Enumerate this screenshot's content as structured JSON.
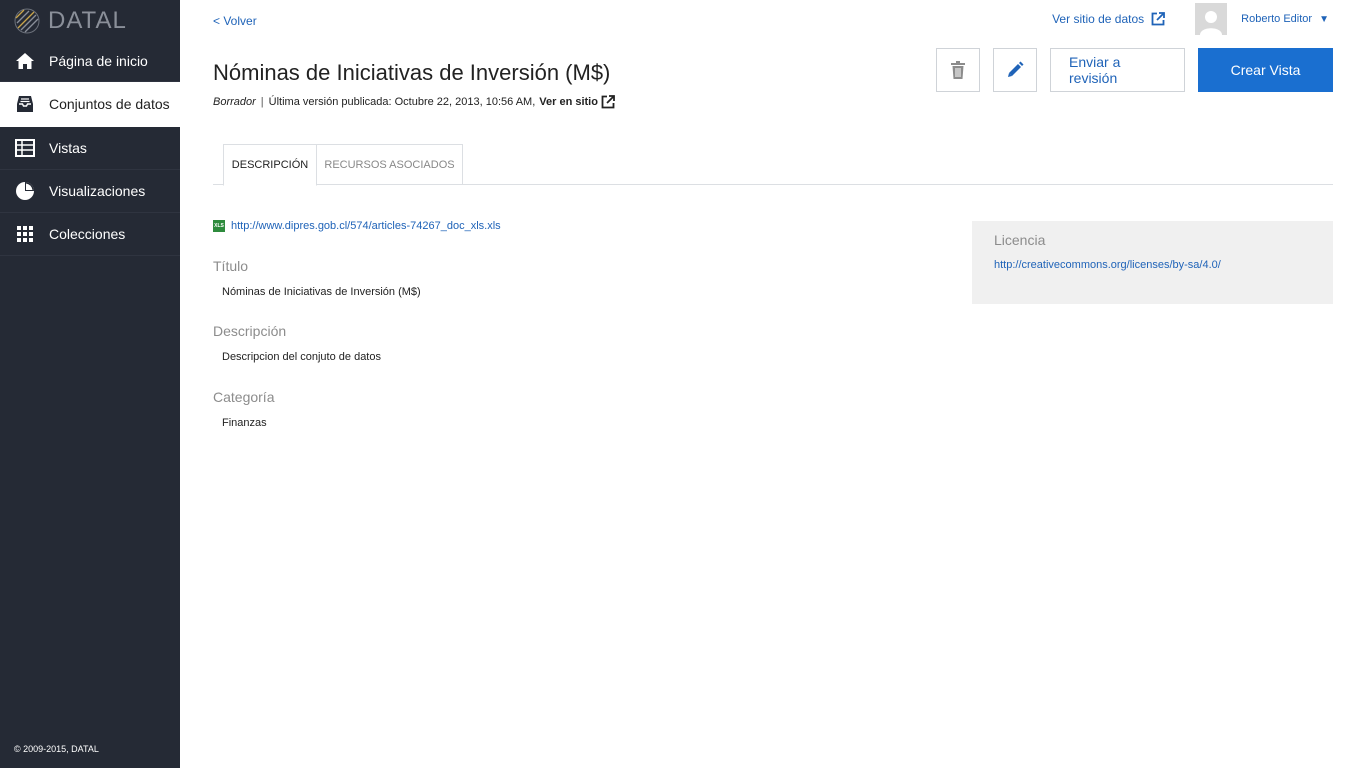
{
  "sidebar": {
    "logo_text": "DATAL",
    "items": [
      {
        "label": "Página de inicio",
        "icon": "home-icon"
      },
      {
        "label": "Conjuntos de datos",
        "icon": "inbox-icon"
      },
      {
        "label": "Vistas",
        "icon": "table-icon"
      },
      {
        "label": "Visualizaciones",
        "icon": "pie-chart-icon"
      },
      {
        "label": "Colecciones",
        "icon": "grid-icon"
      }
    ],
    "active_index": 1,
    "footer": "© 2009-2015, DATAL"
  },
  "header": {
    "back_label": "< Volver",
    "site_link_label": "Ver sitio de datos",
    "user_name": "Roberto Editor",
    "user_caret": "▼"
  },
  "dataset": {
    "title": "Nóminas de Iniciativas de Inversión (M$)",
    "status": "Borrador",
    "separator": "|",
    "published_text": "Última versión publicada: Octubre 22, 2013, 10:56 AM,",
    "view_site_label": "Ver en sitio"
  },
  "actions": {
    "delete_icon": "trash-icon",
    "edit_icon": "pencil-icon",
    "review_label": "Enviar a revisión",
    "create_view_label": "Crear Vista"
  },
  "tabs": [
    {
      "label": "DESCRIPCIÓN",
      "active": true
    },
    {
      "label": "RECURSOS ASOCIADOS",
      "active": false
    }
  ],
  "content": {
    "file_badge": "XLS",
    "file_url": "http://www.dipres.gob.cl/574/articles-74267_doc_xls.xls",
    "fields": [
      {
        "label": "Título",
        "value": "Nóminas de Iniciativas de Inversión (M$)"
      },
      {
        "label": "Descripción",
        "value": "Descripcion del conjuto de datos"
      },
      {
        "label": "Categoría",
        "value": "Finanzas"
      }
    ],
    "license_label": "Licencia",
    "license_url": "http://creativecommons.org/licenses/by-sa/4.0/"
  },
  "colors": {
    "sidebar_bg": "#252a35",
    "link": "#1f63b8",
    "primary": "#1a6fd0"
  }
}
